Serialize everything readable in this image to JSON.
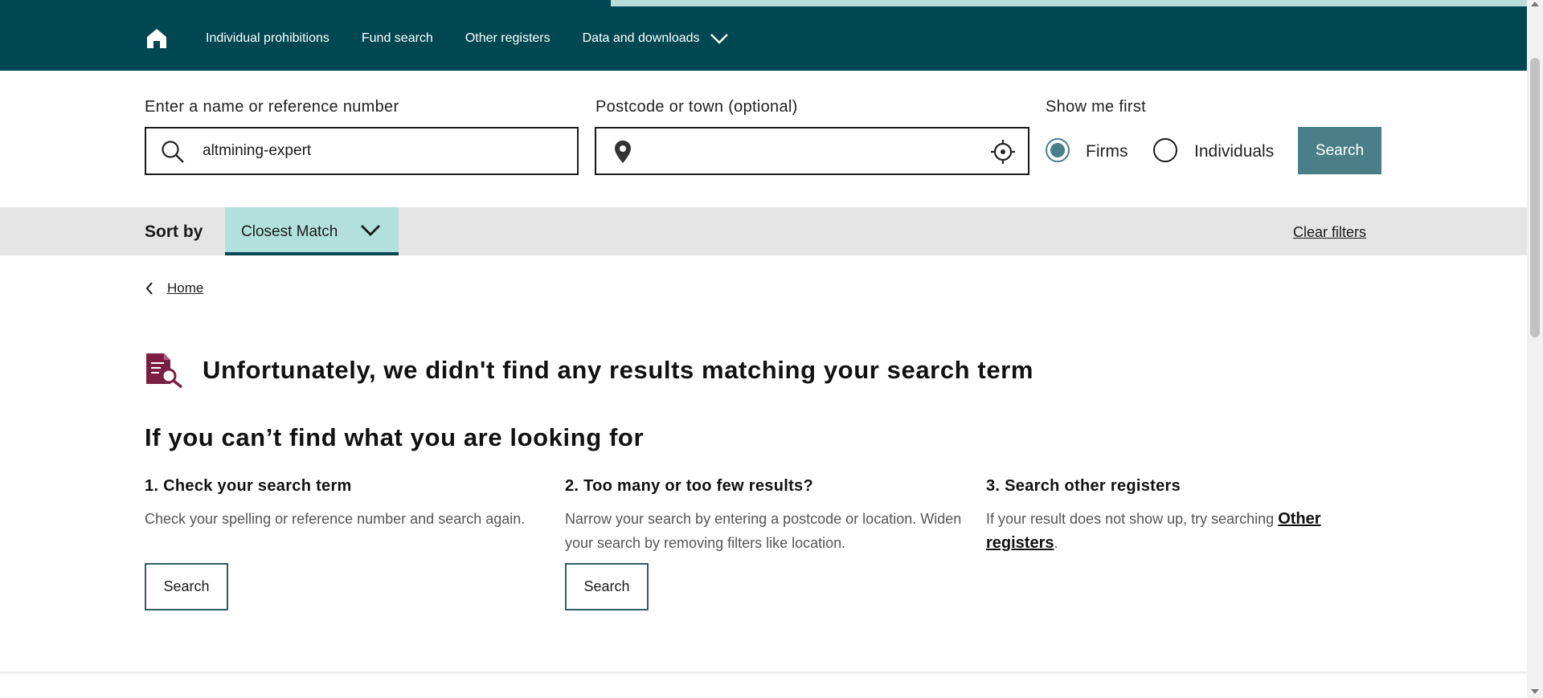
{
  "nav": {
    "home_icon": "home-icon",
    "items": [
      "Individual prohibitions",
      "Fund search",
      "Other registers"
    ],
    "dropdown_label": "Data and downloads"
  },
  "search": {
    "name_label": "Enter a name or reference number",
    "name_value": "altmining-expert",
    "location_label": "Postcode or town (optional)",
    "location_value": "",
    "show_first_label": "Show me first",
    "options": [
      "Firms",
      "Individuals"
    ],
    "selected_option": "Firms",
    "button_label": "Search"
  },
  "sort": {
    "label": "Sort by",
    "selected": "Closest Match",
    "clear_label": "Clear filters"
  },
  "breadcrumb": {
    "home_label": "Home"
  },
  "results": {
    "no_results_message": "Unfortunately, we didn't find any results matching your search term",
    "help_title": "If you can’t find what you are looking for",
    "tips": [
      {
        "title": "1. Check your search term",
        "text": "Check your spelling or reference number and search again.",
        "button": "Search"
      },
      {
        "title": "2. Too many or too few results?",
        "text": "Narrow your search by entering a postcode or location. Widen your search by removing filters like location.",
        "button": "Search"
      },
      {
        "title": "3. Search other registers",
        "text_before": "If your result does not show up, try searching ",
        "link": "Other registers",
        "text_after": "."
      }
    ]
  },
  "colors": {
    "nav_bg": "#004851",
    "accent_teal": "#4a7f88",
    "sort_bg": "#b2e0dc",
    "icon_maroon": "#7a1f44"
  }
}
